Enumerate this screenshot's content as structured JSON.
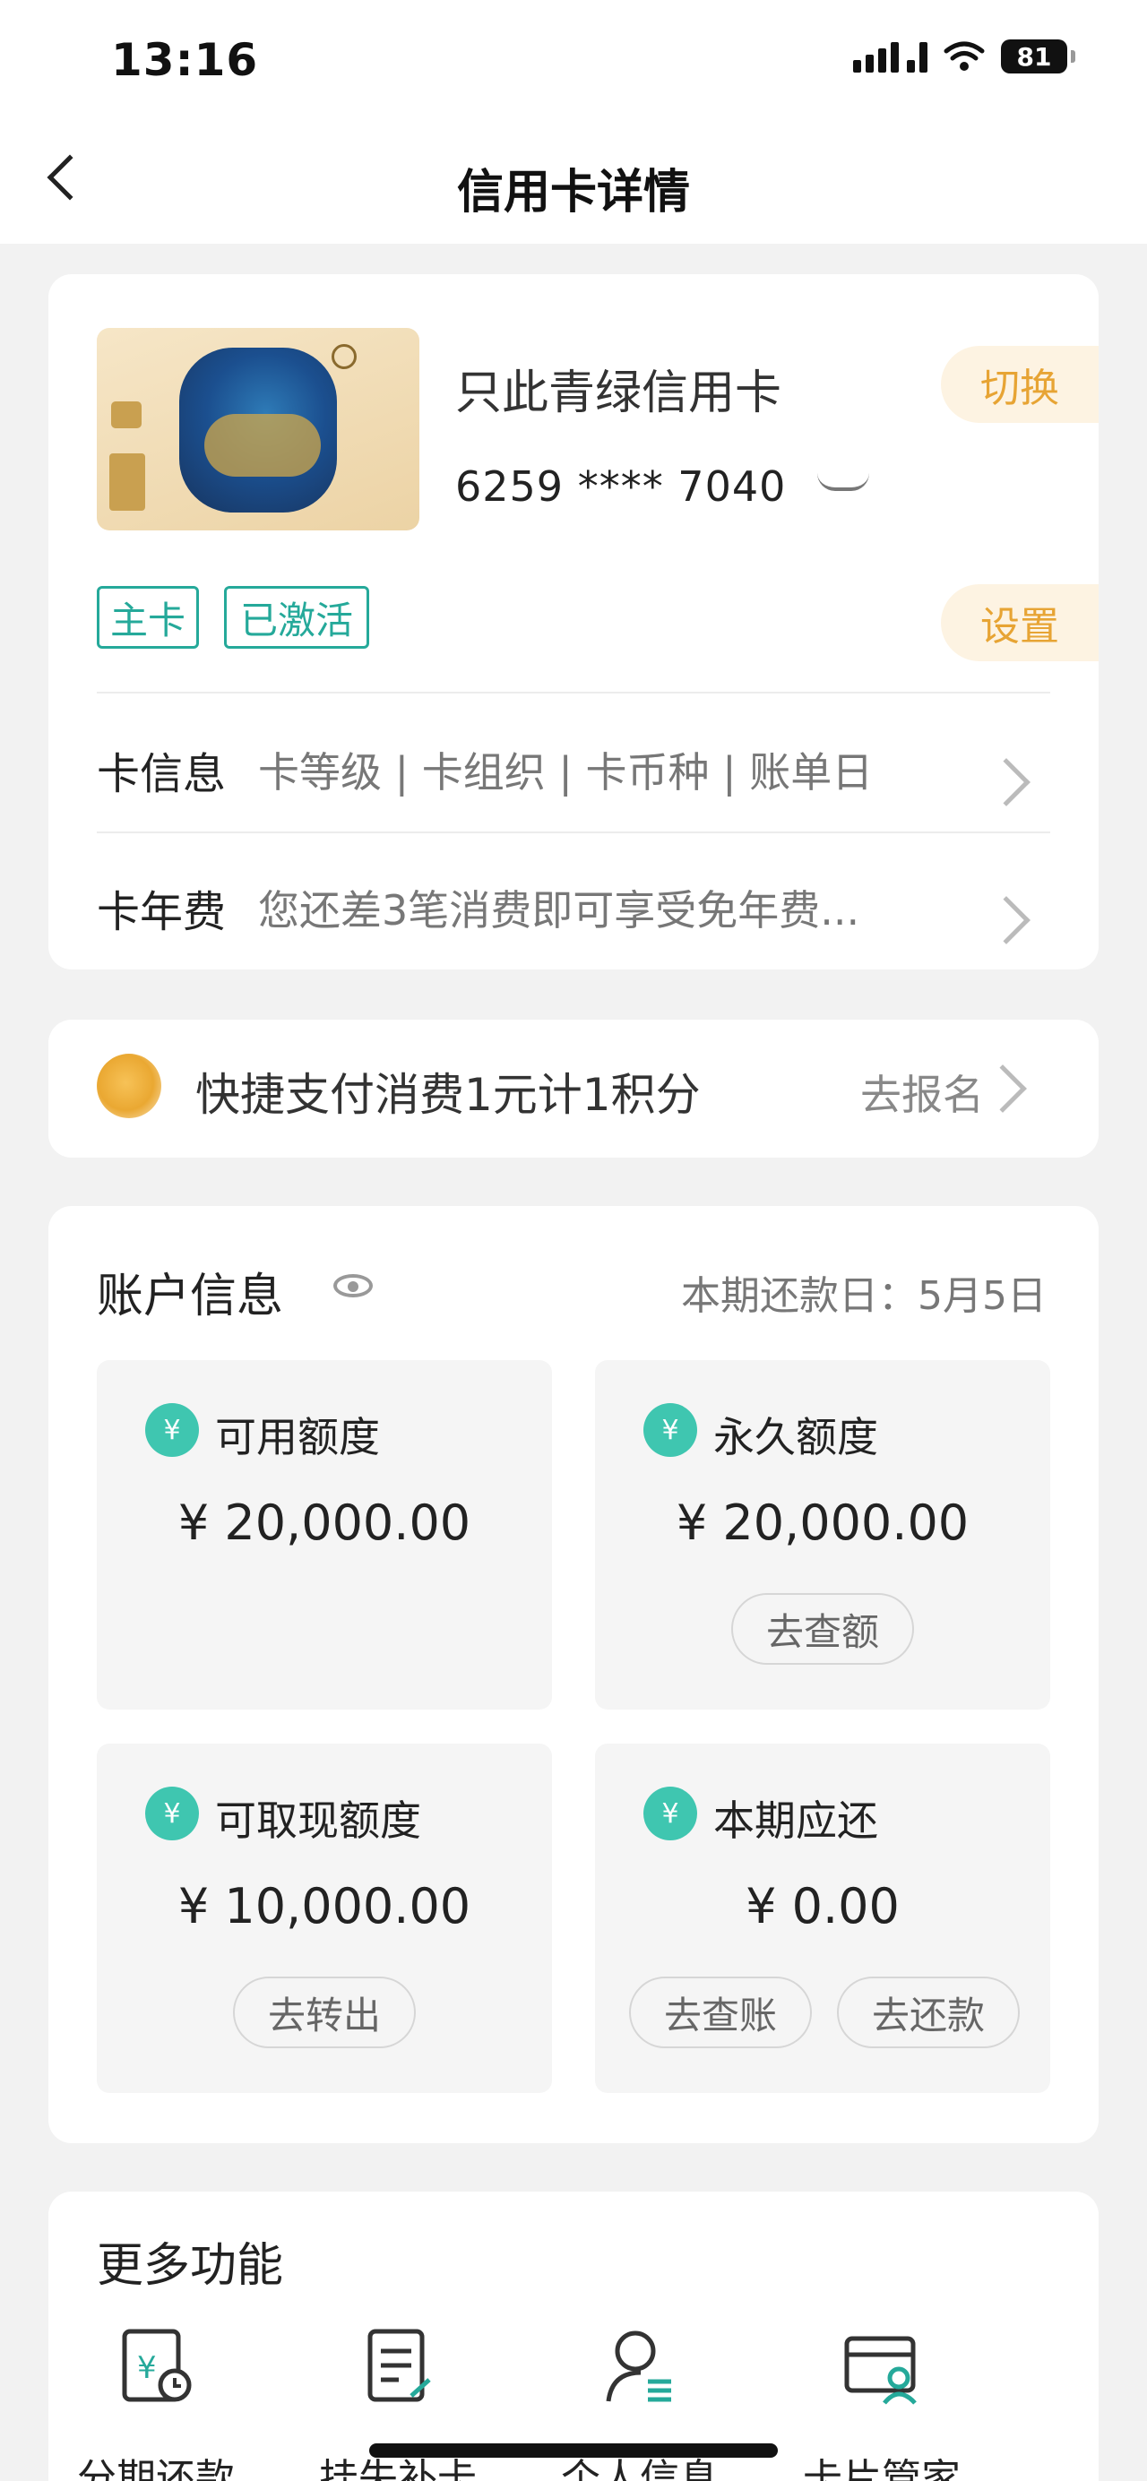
{
  "status_bar": {
    "time": "13:16",
    "battery": "81"
  },
  "nav": {
    "title": "信用卡详情"
  },
  "card": {
    "name": "只此青绿信用卡",
    "number": "6259 **** 7040",
    "switch_label": "切换",
    "settings_label": "设置",
    "tags": [
      "主卡",
      "已激活"
    ],
    "info_label": "卡信息",
    "info_value": "卡等级 | 卡组织 | 卡币种 | 账单日",
    "fee_label": "卡年费",
    "fee_value": "您还差3笔消费即可享受免年费..."
  },
  "promo": {
    "text": "快捷支付消费1元计1积分",
    "link": "去报名"
  },
  "account": {
    "title": "账户信息",
    "due_date": "本期还款日：5月5日",
    "tiles": [
      {
        "label": "可用额度",
        "amount": "¥ 20,000.00",
        "actions": []
      },
      {
        "label": "永久额度",
        "amount": "¥ 20,000.00",
        "actions": [
          "去查额"
        ]
      },
      {
        "label": "可取现额度",
        "amount": "¥ 10,000.00",
        "actions": [
          "去转出"
        ]
      },
      {
        "label": "本期应还",
        "amount": "¥ 0.00",
        "actions": [
          "去查账",
          "去还款"
        ]
      }
    ]
  },
  "more": {
    "title": "更多功能",
    "items": [
      {
        "label": "分期还款",
        "icon": "installment-icon"
      },
      {
        "label": "挂失补卡",
        "icon": "report-loss-icon"
      },
      {
        "label": "个人信息",
        "icon": "personal-info-icon"
      },
      {
        "label": "卡片管家",
        "icon": "card-manager-icon"
      }
    ]
  },
  "colors": {
    "accent": "#25a99a",
    "orange": "#e7a434",
    "tile_icon": "#3fc6b0"
  }
}
